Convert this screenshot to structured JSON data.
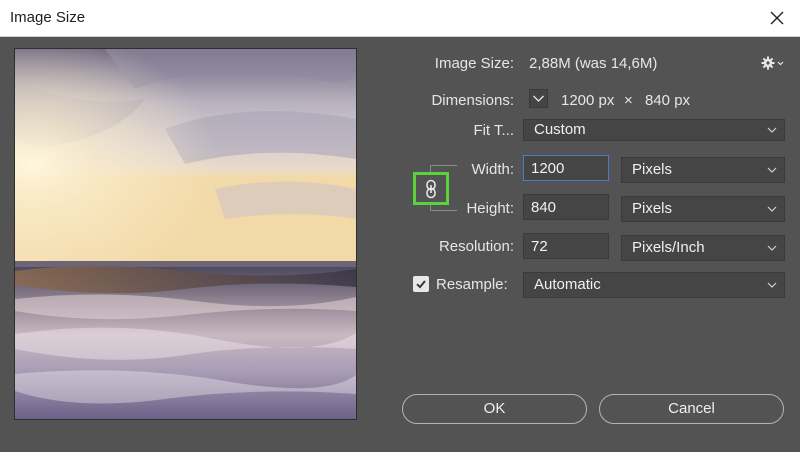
{
  "window": {
    "title": "Image Size"
  },
  "image_size": {
    "label": "Image Size:",
    "value": "2,88M (was 14,6M)"
  },
  "dimensions": {
    "label": "Dimensions:",
    "width": "1200 px",
    "times": "×",
    "height": "840 px"
  },
  "fit_to": {
    "label": "Fit T...",
    "value": "Custom"
  },
  "width": {
    "label": "Width:",
    "value": "1200",
    "unit": "Pixels"
  },
  "height": {
    "label": "Height:",
    "value": "840",
    "unit": "Pixels"
  },
  "resolution": {
    "label": "Resolution:",
    "value": "72",
    "unit": "Pixels/Inch"
  },
  "resample": {
    "label": "Resample:",
    "checked": true,
    "value": "Automatic"
  },
  "buttons": {
    "ok": "OK",
    "cancel": "Cancel"
  },
  "colors": {
    "panel": "#535353",
    "field": "#454545",
    "link_highlight": "#5ad33a",
    "focus_border": "#4d7bbf"
  },
  "icons": {
    "settings": "gear-icon",
    "link": "chain-link-icon",
    "close": "close-icon",
    "dropdown": "chevron-down-icon"
  }
}
